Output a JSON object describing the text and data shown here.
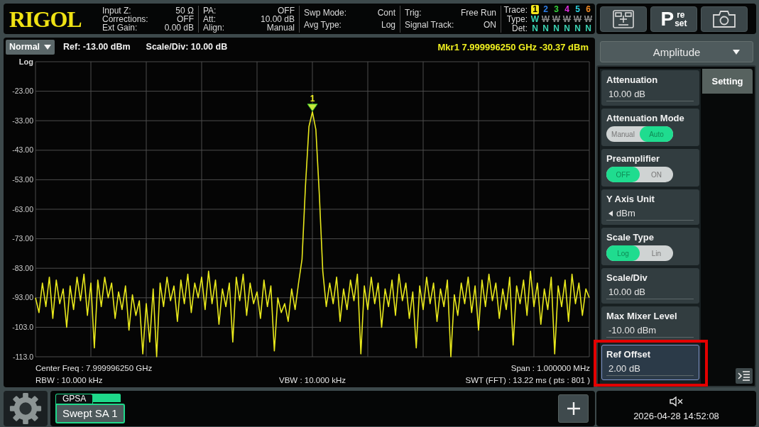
{
  "header": {
    "logo": "RIGOL",
    "status_groups": [
      {
        "rows": [
          {
            "label": "Input Z:",
            "value": "50 Ω"
          },
          {
            "label": "Corrections:",
            "value": "OFF"
          },
          {
            "label": "Ext Gain:",
            "value": "0.00 dB"
          }
        ]
      },
      {
        "rows": [
          {
            "label": "PA:",
            "value": "OFF"
          },
          {
            "label": "Att:",
            "value": "10.00 dB"
          },
          {
            "label": "Align:",
            "value": "Manual"
          }
        ]
      },
      {
        "rows": [
          {
            "label": "Swp Mode:",
            "value": "Cont"
          },
          {
            "label": "Avg Type:",
            "value": "Log"
          }
        ]
      },
      {
        "rows": [
          {
            "label": "Trig:",
            "value": "Free Run"
          },
          {
            "label": "Signal Track:",
            "value": "ON"
          }
        ]
      }
    ],
    "trace_panel": {
      "trace_label": "Trace:",
      "type_label": "Type:",
      "det_label": "Det:",
      "traces": [
        {
          "number": "1",
          "color": "#f5e61a",
          "selected": true,
          "type": "W",
          "type_active": true,
          "det": "N"
        },
        {
          "number": "2",
          "color": "#2f7fe8",
          "selected": false,
          "type": "W",
          "type_active": false,
          "det": "N"
        },
        {
          "number": "3",
          "color": "#35d33c",
          "selected": false,
          "type": "W",
          "type_active": false,
          "det": "N"
        },
        {
          "number": "4",
          "color": "#e02ee0",
          "selected": false,
          "type": "W",
          "type_active": false,
          "det": "N"
        },
        {
          "number": "5",
          "color": "#2ed3e0",
          "selected": false,
          "type": "W",
          "type_active": false,
          "det": "N"
        },
        {
          "number": "6",
          "color": "#f08a24",
          "selected": false,
          "type": "W",
          "type_active": false,
          "det": "N"
        }
      ]
    }
  },
  "toolbar_buttons": [
    {
      "kind": "window"
    },
    {
      "kind": "preset",
      "initial": "P",
      "line_1": "re",
      "line_2": "set"
    },
    {
      "kind": "camera"
    }
  ],
  "display": {
    "mode_dropdown": "Normal",
    "ref": "Ref: -13.00 dBm",
    "scale": "Scale/Div: 10.00 dB",
    "marker_readout": "Mkr1 7.999996250 GHz -30.37 dBm",
    "chart_data": {
      "type": "line",
      "ylabel": "Log",
      "ylim": [
        -113,
        -13
      ],
      "grid": true,
      "yticks": [
        {
          "value": -23,
          "label": "-23.00"
        },
        {
          "value": -33,
          "label": "-33.00"
        },
        {
          "value": -43,
          "label": "-43.00"
        },
        {
          "value": -53,
          "label": "-53.00"
        },
        {
          "value": -63,
          "label": "-63.00"
        },
        {
          "value": -73,
          "label": "-73.00"
        },
        {
          "value": -83,
          "label": "-83.00"
        },
        {
          "value": -93,
          "label": "-93.00"
        },
        {
          "value": -103,
          "label": "-103.0"
        },
        {
          "value": -113,
          "label": "-113.0"
        }
      ],
      "series": [
        {
          "color": "#e8e81c",
          "values": [
            -93,
            -98,
            -88,
            -96,
            -86,
            -100,
            -87,
            -95,
            -90,
            -103,
            -89,
            -97,
            -86,
            -94,
            -85,
            -99,
            -88,
            -110,
            -87,
            -96,
            -86,
            -93,
            -88,
            -100,
            -91,
            -97,
            -89,
            -104,
            -92,
            -99,
            -94,
            -112,
            -95,
            -108,
            -90,
            -113,
            -88,
            -96,
            -86,
            -94,
            -89,
            -101,
            -87,
            -95,
            -85,
            -98,
            -88,
            -93,
            -86,
            -97,
            -84,
            -95,
            -87,
            -102,
            -90,
            -96,
            -88,
            -108,
            -86,
            -94,
            -85,
            -99,
            -88,
            -95,
            -91,
            -100,
            -87,
            -96,
            -89,
            -111,
            -93,
            -98,
            -95,
            -101,
            -90,
            -97,
            -88,
            -80,
            -55,
            -35,
            -30,
            -36,
            -58,
            -84,
            -96,
            -88,
            -95,
            -86,
            -101,
            -90,
            -97,
            -87,
            -94,
            -85,
            -112,
            -89,
            -97,
            -86,
            -95,
            -88,
            -103,
            -90,
            -96,
            -87,
            -99,
            -85,
            -94,
            -88,
            -100,
            -91,
            -110,
            -89,
            -97,
            -86,
            -95,
            -88,
            -101,
            -90,
            -96,
            -87,
            -113,
            -92,
            -99,
            -88,
            -95,
            -86,
            -98,
            -89,
            -104,
            -87,
            -96,
            -85,
            -94,
            -88,
            -100,
            -90,
            -97,
            -86,
            -109,
            -89,
            -95,
            -87,
            -99,
            -84,
            -96,
            -88,
            -102,
            -90,
            -97,
            -86,
            -112,
            -89,
            -96,
            -87,
            -101,
            -85,
            -95,
            -88,
            -99,
            -90,
            -93
          ]
        }
      ],
      "annotations": [
        {
          "y": -30,
          "text": "1"
        }
      ]
    },
    "footer": {
      "center_freq": "Center Freq : 7.999996250 GHz",
      "span": "Span : 1.000000 MHz",
      "rbw": "RBW : 10.000 kHz",
      "vbw": "VBW : 10.000 kHz",
      "swt": "SWT (FFT) : 13.22 ms ( pts : 801 )"
    }
  },
  "menu": {
    "title": "Amplitude",
    "tabs": [
      {
        "label": "Setting",
        "selected": true
      }
    ],
    "items": [
      {
        "kind": "value",
        "label": "Attenuation",
        "value": "10.00 dB",
        "selected": false,
        "highlighted": false
      },
      {
        "kind": "toggle",
        "label": "Attenuation Mode",
        "options": [
          {
            "label": "Manual",
            "selected": false
          },
          {
            "label": "Auto",
            "selected": true
          }
        ],
        "selected": false,
        "highlighted": false
      },
      {
        "kind": "toggle",
        "label": "Preamplifier",
        "options": [
          {
            "label": "OFF",
            "selected": true
          },
          {
            "label": "ON",
            "selected": false
          }
        ],
        "selected": false,
        "highlighted": false
      },
      {
        "kind": "select",
        "label": "Y Axis Unit",
        "value": "dBm",
        "selected": false,
        "highlighted": false
      },
      {
        "kind": "toggle",
        "label": "Scale Type",
        "options": [
          {
            "label": "Log",
            "selected": true
          },
          {
            "label": "Lin",
            "selected": false
          }
        ],
        "selected": false,
        "highlighted": false
      },
      {
        "kind": "value",
        "label": "Scale/Div",
        "value": "10.00 dB",
        "selected": false,
        "highlighted": false
      },
      {
        "kind": "value",
        "label": "Max Mixer Level",
        "value": "-10.00 dBm",
        "selected": false,
        "highlighted": false
      },
      {
        "kind": "value",
        "label": "Ref Offset",
        "value": "2.00 dB",
        "selected": true,
        "highlighted": true
      }
    ]
  },
  "bottom": {
    "app_tabs": [
      {
        "group": "GPSA",
        "label": "Swept SA 1",
        "selected": true
      }
    ],
    "status": {
      "muted": true,
      "datetime": "2026-04-28 14:52:08"
    }
  }
}
